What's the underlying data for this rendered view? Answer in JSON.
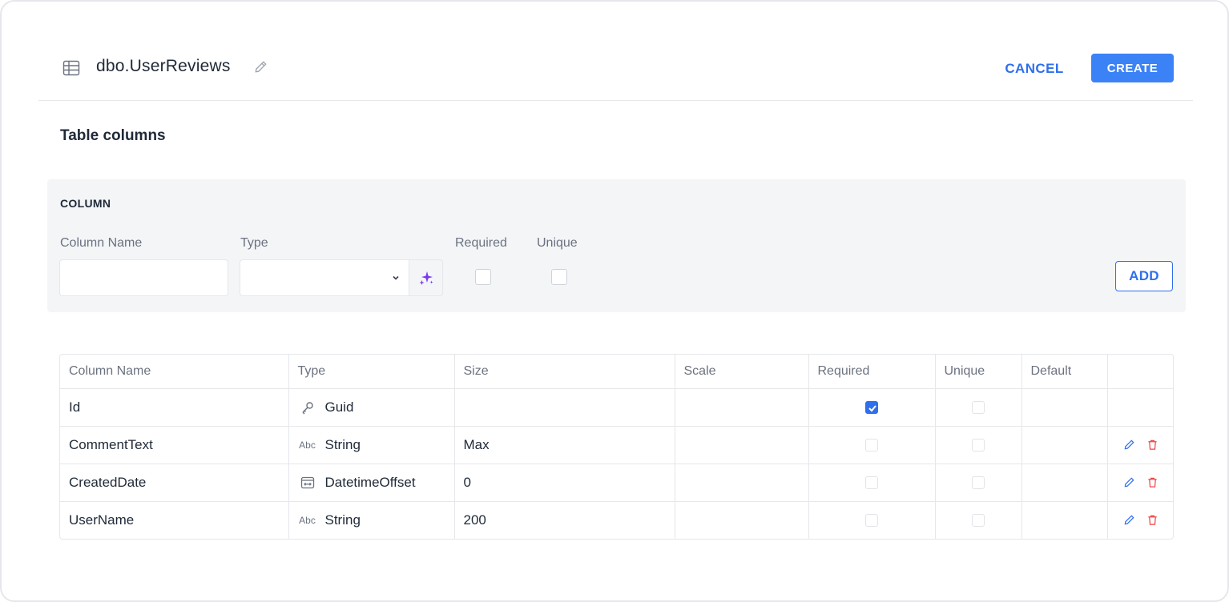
{
  "header": {
    "title": "dbo.UserReviews",
    "cancel_label": "CANCEL",
    "create_label": "CREATE",
    "icons": [
      "table-icon",
      "pencil-icon"
    ]
  },
  "section_title": "Table columns",
  "column_form": {
    "heading": "COLUMN",
    "name_label": "Column Name",
    "name_value": "",
    "type_label": "Type",
    "type_value": "",
    "required_label": "Required",
    "unique_label": "Unique",
    "required_checked": false,
    "unique_checked": false,
    "add_label": "ADD",
    "icons": [
      "chevron-down-icon",
      "sparkle-icon"
    ]
  },
  "columns_table": {
    "headers": [
      "Column Name",
      "Type",
      "Size",
      "Scale",
      "Required",
      "Unique",
      "Default",
      ""
    ],
    "rows": [
      {
        "name": "Id",
        "type_icon": "key-icon",
        "type": "Guid",
        "size": "",
        "scale": "",
        "required": true,
        "unique": false,
        "default": "",
        "editable": false
      },
      {
        "name": "CommentText",
        "type_icon": "abc-icon",
        "type_icon_text": "Abc",
        "type": "String",
        "size": "Max",
        "scale": "",
        "required": false,
        "unique": false,
        "default": "",
        "editable": true
      },
      {
        "name": "CreatedDate",
        "type_icon": "datetime-icon",
        "type": "DatetimeOffset",
        "size": "0",
        "scale": "",
        "required": false,
        "unique": false,
        "default": "",
        "editable": true
      },
      {
        "name": "UserName",
        "type_icon": "abc-icon",
        "type_icon_text": "Abc",
        "type": "String",
        "size": "200",
        "scale": "",
        "required": false,
        "unique": false,
        "default": "",
        "editable": true
      }
    ]
  },
  "colors": {
    "accent": "#2f6fed",
    "primary_button": "#3b82f6",
    "delete": "#ef4444",
    "sparkle": "#7c3aed"
  }
}
